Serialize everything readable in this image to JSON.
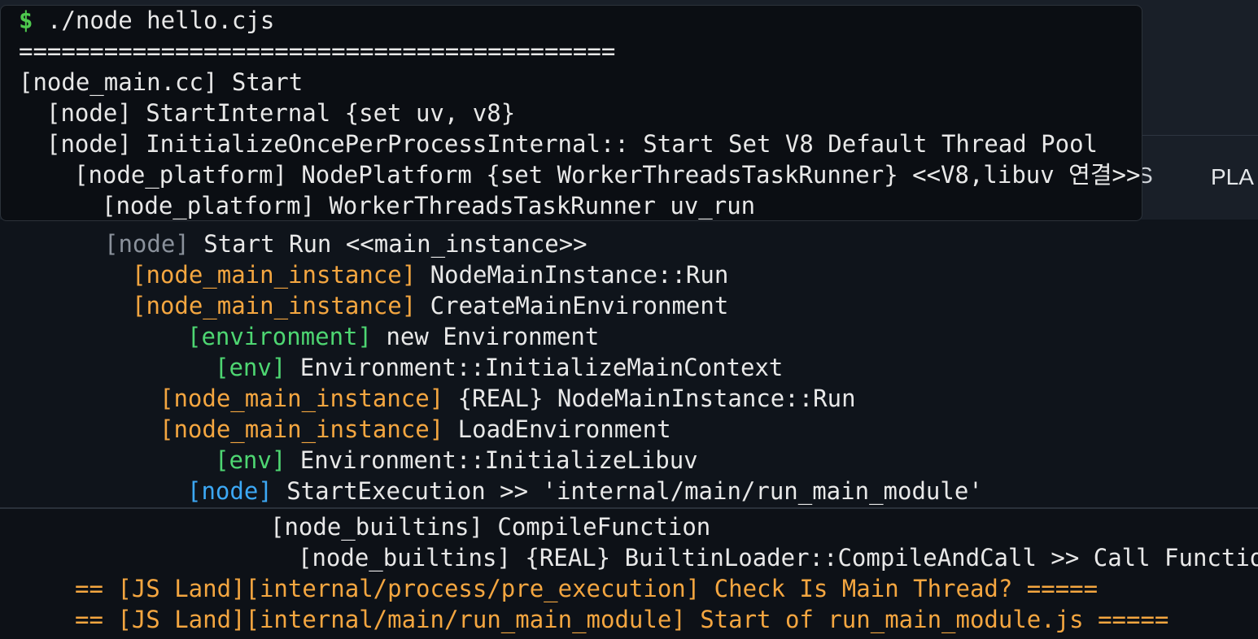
{
  "terminal": {
    "prompt_symbol": "$",
    "command": "./node hello.cjs",
    "separator": "==========================================",
    "popup_lines": [
      "[node_main.cc] Start",
      "[node] StartInternal {set uv, v8}",
      "[node] InitializeOncePerProcessInternal:: Start Set V8 Default Thread Pool",
      "[node_platform] NodePlatform {set WorkerThreadsTaskRunner} <<V8,libuv 연결>>",
      "[node_platform] WorkerThreadsTaskRunner uv_run"
    ],
    "background_text_fragment": "S",
    "background_text_pla": "PLA",
    "middle_lines": [
      {
        "tag": "[node]",
        "text": " Start Run <<main_instance>>"
      },
      {
        "tag": "[node_main_instance]",
        "text": " NodeMainInstance::Run"
      },
      {
        "tag": "[node_main_instance]",
        "text": " CreateMainEnvironment"
      },
      {
        "tag": "[environment]",
        "text": " new Environment"
      },
      {
        "tag": "[env]",
        "text": " Environment::InitializeMainContext"
      },
      {
        "tag": "[node_main_instance]",
        "text": " {REAL} NodeMainInstance::Run"
      },
      {
        "tag": "[node_main_instance]",
        "text": " LoadEnvironment"
      },
      {
        "tag": "[env]",
        "text": " Environment::InitializeLibuv"
      },
      {
        "tag": "[node]",
        "text": " StartExecution >> 'internal/main/run_main_module'"
      }
    ],
    "bottom_lines": [
      {
        "tag": "[node_builtins]",
        "text": " CompileFunction"
      },
      {
        "tag": "[node_builtins]",
        "text": " {REAL} BuiltinLoader::CompileAndCall >> Call Function"
      },
      {
        "text": "== [JS Land][internal/process/pre_execution] Check Is Main Thread? ====="
      },
      {
        "text": "== [JS Land][internal/main/run_main_module] Start of run_main_module.js ====="
      }
    ]
  },
  "colors": {
    "prompt": "#4ec94e",
    "tag_gray": "#8a919b",
    "tag_orange": "#f4a640",
    "tag_green": "#4ed672",
    "tag_blue": "#3ca8f5",
    "text": "#e8e8e8"
  }
}
